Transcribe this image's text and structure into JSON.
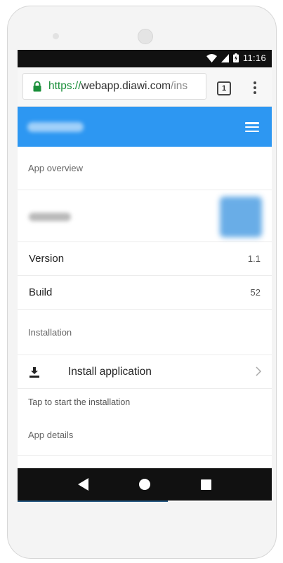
{
  "status_bar": {
    "time": "11:16",
    "icons": [
      "wifi-icon",
      "signal-icon",
      "battery-icon"
    ]
  },
  "browser": {
    "url_scheme": "https://",
    "url_host": "webapp.diawi.com",
    "url_path": "/ins",
    "tab_count": "1"
  },
  "app_header": {
    "title": "",
    "menu_icon": "hamburger-icon",
    "background": "#2d97f2"
  },
  "overview": {
    "section_title": "App overview",
    "app_name": "",
    "rows": [
      {
        "label": "Version",
        "value": "1.1"
      },
      {
        "label": "Build",
        "value": "52"
      }
    ]
  },
  "installation": {
    "section_title": "Installation",
    "action_label": "Install application",
    "action_icon": "download-icon",
    "hint": "Tap to start the installation"
  },
  "details": {
    "section_title": "App details"
  },
  "colors": {
    "accent": "#2d97f2",
    "secure": "#1a8f3a"
  }
}
